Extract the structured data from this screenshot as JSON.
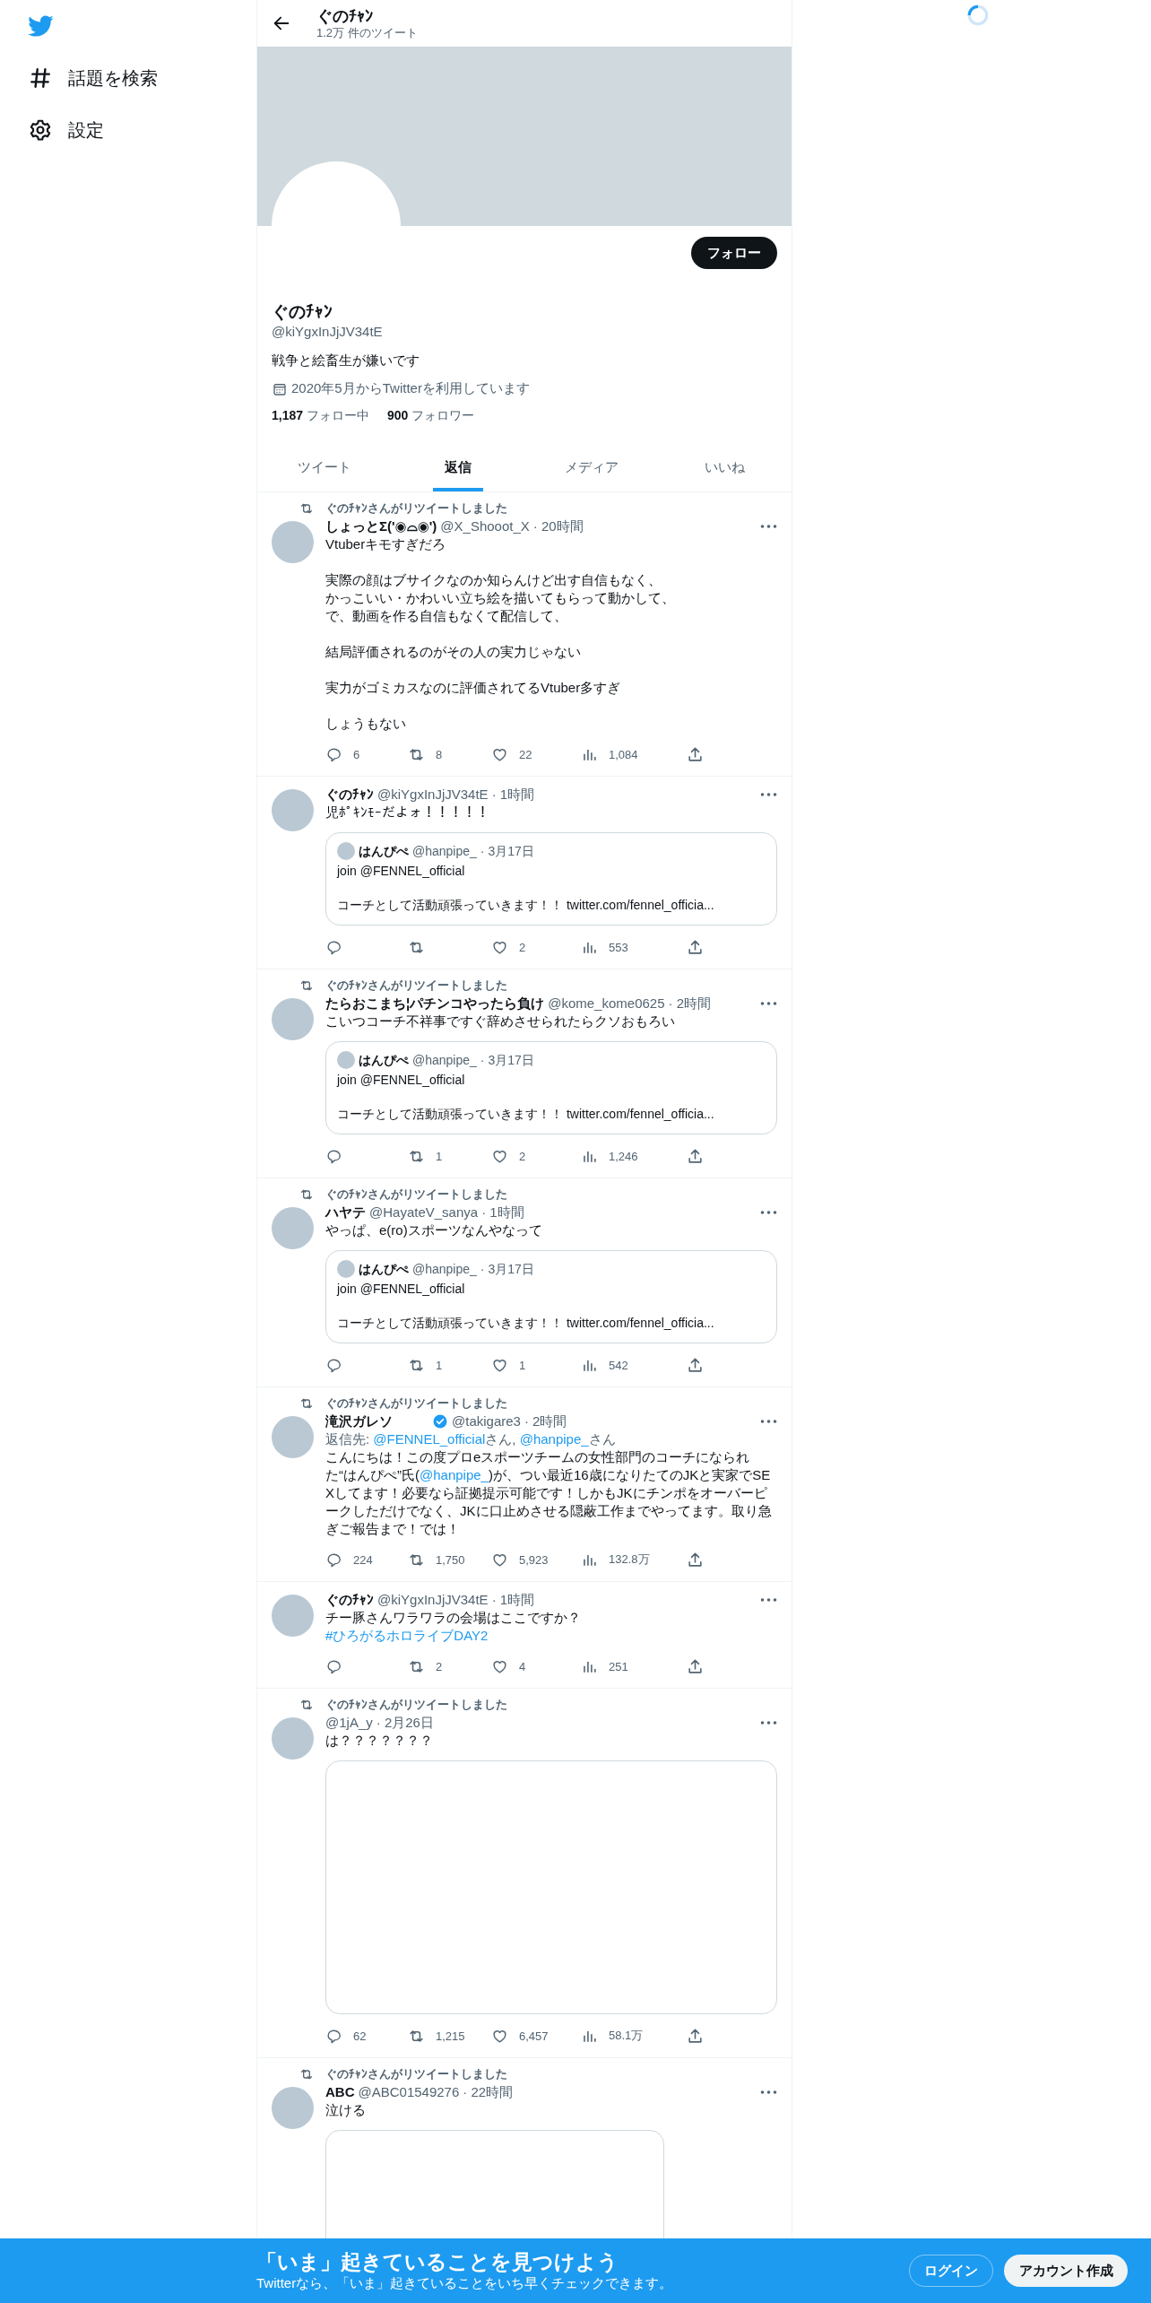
{
  "sidebar": {
    "items": [
      {
        "kind": "hash",
        "label": "話題を検索"
      },
      {
        "kind": "gear",
        "label": "設定"
      }
    ]
  },
  "header": {
    "title": "ぐのﾁｬﾝ",
    "subtitle": "1.2万 件のツイート"
  },
  "profile": {
    "follow_button": "フォロー",
    "name": "ぐのﾁｬﾝ",
    "handle": "@kiYgxInJjJV34tE",
    "bio": "戦争と絵畜生が嫌いです",
    "joined": "2020年5月からTwitterを利用しています",
    "following_count": "1,187",
    "following_label": "フォロー中",
    "followers_count": "900",
    "followers_label": "フォロワー"
  },
  "tabs": [
    {
      "label": "ツイート",
      "selected": false
    },
    {
      "label": "返信",
      "selected": true
    },
    {
      "label": "メディア",
      "selected": false
    },
    {
      "label": "いいね",
      "selected": false
    }
  ],
  "tweets": [
    {
      "retweeted_by": "ぐのﾁｬﾝさんがリツイートしました",
      "name": "しょっとΣ('◉⌓◉')",
      "verified": false,
      "handle": "@X_Shooot_X",
      "time": "· 20時間",
      "text": [
        [
          [
            {
              "kind": "plain",
              "text": "Vtuberキモすぎだろ"
            }
          ]
        ],
        [
          [
            {
              "kind": "plain",
              "text": "実際の顔はブサイクなのか知らんけど出す自信もなく、"
            }
          ],
          [
            {
              "kind": "plain",
              "text": "かっこいい・かわいい立ち絵を描いてもらって動かして、"
            }
          ],
          [
            {
              "kind": "plain",
              "text": "で、動画を作る自信もなくて配信して、"
            }
          ]
        ],
        [
          [
            {
              "kind": "plain",
              "text": "結局評価されるのがその人の実力じゃない"
            }
          ]
        ],
        [
          [
            {
              "kind": "plain",
              "text": "実力がゴミカスなのに評価されてるVtuber多すぎ"
            }
          ]
        ],
        [
          [
            {
              "kind": "plain",
              "text": "しょうもない"
            }
          ]
        ]
      ],
      "stats": {
        "replies": "6",
        "retweets": "8",
        "likes": "22",
        "views": "1,084"
      }
    },
    {
      "name": "ぐのﾁｬﾝ",
      "verified": false,
      "handle": "@kiYgxInJjJV34tE",
      "time": "· 1時間",
      "text": [
        [
          [
            {
              "kind": "plain",
              "text": "児ﾎﾟｷﾝﾓｰだよォ！！！！！"
            }
          ]
        ]
      ],
      "quote": {
        "name": "はんぴぺ",
        "handle": "@hanpipe_",
        "time": "· 3月17日",
        "text": [
          "join @FENNEL_official",
          "コーチとして活動頑張っていきます！！ twitter.com/fennel_officia..."
        ]
      },
      "stats": {
        "likes": "2",
        "views": "553"
      }
    },
    {
      "retweeted_by": "ぐのﾁｬﾝさんがリツイートしました",
      "name": "たらおこまち¦パチンコやったら負け",
      "verified": false,
      "handle": "@kome_kome0625",
      "time": "· 2時間",
      "text": [
        [
          [
            {
              "kind": "plain",
              "text": "こいつコーチ不祥事ですぐ辞めさせられたらクソおもろい"
            }
          ]
        ]
      ],
      "quote": {
        "name": "はんぴぺ",
        "handle": "@hanpipe_",
        "time": "· 3月17日",
        "text": [
          "join @FENNEL_official",
          "コーチとして活動頑張っていきます！！ twitter.com/fennel_officia..."
        ]
      },
      "stats": {
        "retweets": "1",
        "likes": "2",
        "views": "1,246"
      }
    },
    {
      "retweeted_by": "ぐのﾁｬﾝさんがリツイートしました",
      "name": "ハヤテ",
      "verified": false,
      "handle": "@HayateV_sanya",
      "time": "· 1時間",
      "text": [
        [
          [
            {
              "kind": "plain",
              "text": "やっぱ、e(ro)スポーツなんやなって"
            }
          ]
        ]
      ],
      "quote": {
        "name": "はんぴぺ",
        "handle": "@hanpipe_",
        "time": "· 3月17日",
        "text": [
          "join @FENNEL_official",
          "コーチとして活動頑張っていきます！！ twitter.com/fennel_officia..."
        ]
      },
      "stats": {
        "retweets": "1",
        "likes": "1",
        "views": "542"
      }
    },
    {
      "retweeted_by": "ぐのﾁｬﾝさんがリツイートしました",
      "name": "滝沢ガレソ",
      "verified": true,
      "handle": "@takigare3",
      "time": "· 2時間",
      "reply_to": [
        {
          "kind": "plain",
          "text": "返信先: "
        },
        {
          "kind": "link",
          "text": "@FENNEL_official"
        },
        {
          "kind": "plain",
          "text": "さん, "
        },
        {
          "kind": "link",
          "text": "@hanpipe_"
        },
        {
          "kind": "plain",
          "text": "さん"
        }
      ],
      "text": [
        [
          [
            {
              "kind": "plain",
              "text": "こんにちは！この度プロeスポーツチームの女性部門のコーチになられた“はんぴぺ”氏("
            },
            {
              "kind": "link",
              "text": "@hanpipe_"
            },
            {
              "kind": "plain",
              "text": ")が、つい最近16歳になりたてのJKと実家でSEXしてます！必要なら証拠提示可能です！しかもJKにチンポをオーバーピークしただけでなく、JKに口止めさせる隠蔽工作までやってます。取り急ぎご報告まで！では！"
            }
          ]
        ]
      ],
      "stats": {
        "replies": "224",
        "retweets": "1,750",
        "likes": "5,923",
        "views": "132.8万"
      }
    },
    {
      "name": "ぐのﾁｬﾝ",
      "verified": false,
      "handle": "@kiYgxInJjJV34tE",
      "time": "· 1時間",
      "text": [
        [
          [
            {
              "kind": "plain",
              "text": "チー豚さんワラワラの会場はここですか？"
            }
          ],
          [
            {
              "kind": "link",
              "text": "#ひろがるホロライブDAY2"
            }
          ]
        ]
      ],
      "stats": {
        "retweets": "2",
        "likes": "4",
        "views": "251"
      }
    },
    {
      "retweeted_by": "ぐのﾁｬﾝさんがリツイートしました",
      "verified": false,
      "handle": "@1jA_y",
      "time": "· 2月26日",
      "text": [
        [
          [
            {
              "kind": "plain",
              "text": "は？？？？？？？"
            }
          ]
        ]
      ],
      "media": {
        "kind": "landscape"
      },
      "stats": {
        "replies": "62",
        "retweets": "1,215",
        "likes": "6,457",
        "views": "58.1万"
      }
    },
    {
      "retweeted_by": "ぐのﾁｬﾝさんがリツイートしました",
      "name": "ABC",
      "verified": false,
      "handle": "@ABC01549276",
      "time": "· 22時間",
      "text": [
        [
          [
            {
              "kind": "plain",
              "text": "泣ける"
            }
          ]
        ]
      ],
      "media": {
        "kind": "portrait"
      }
    }
  ],
  "banner": {
    "title": "「いま」起きていることを見つけよう",
    "subtitle": "Twitterなら、「いま」起きていることをいち早くチェックできます。",
    "login": "ログイン",
    "signup": "アカウント作成"
  }
}
